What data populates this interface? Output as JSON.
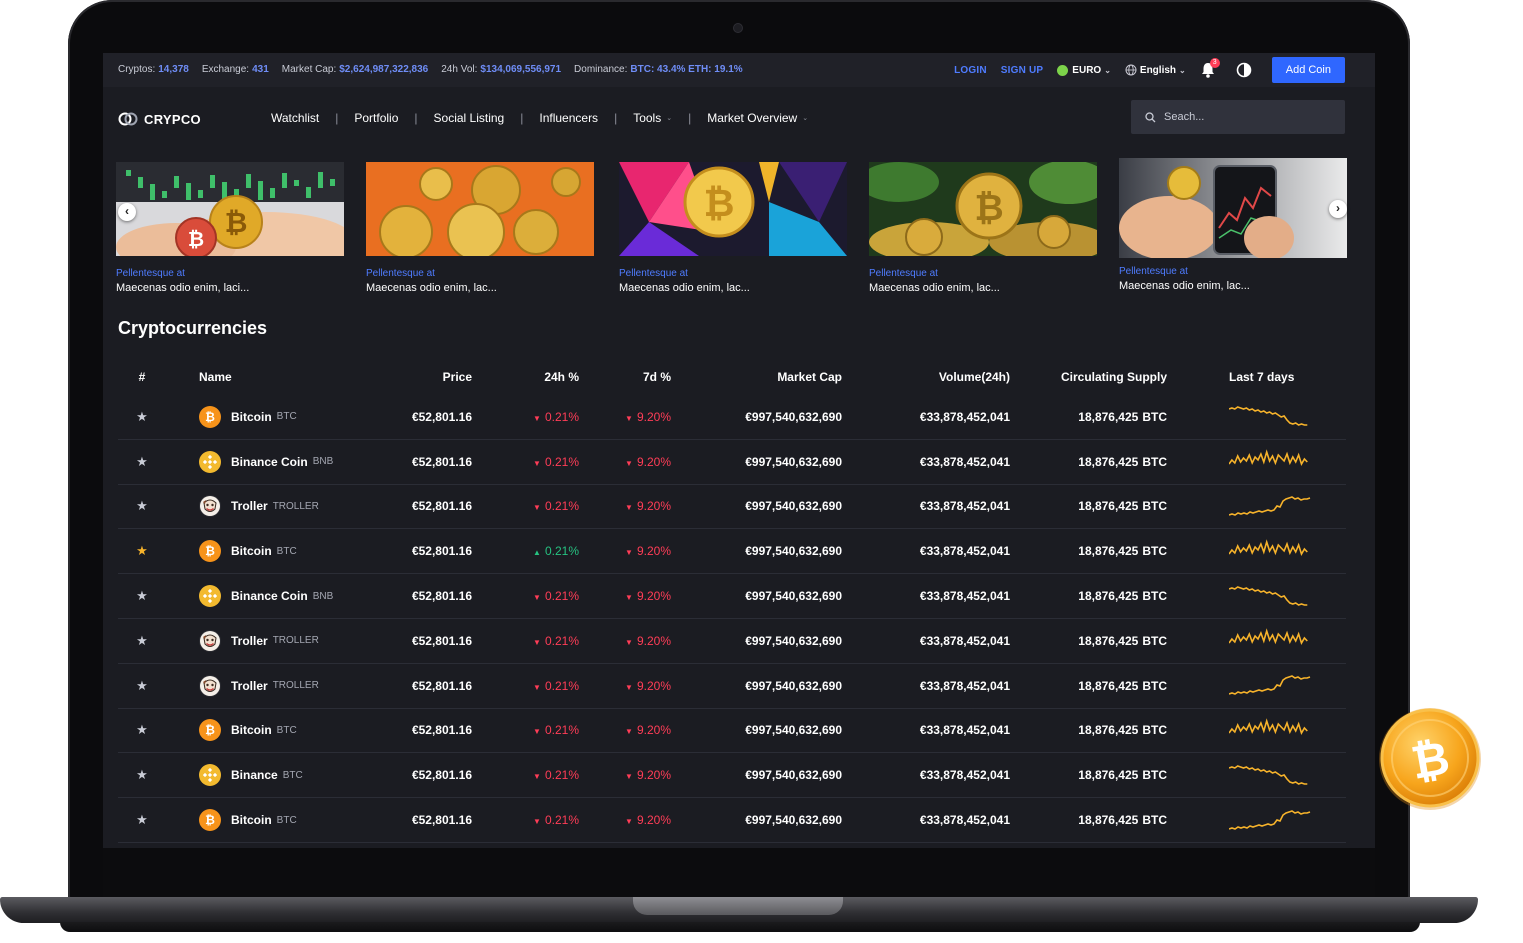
{
  "stats": [
    {
      "label": "Cryptos:",
      "value": "14,378"
    },
    {
      "label": "Exchange:",
      "value": "431"
    },
    {
      "label": "Market Cap:",
      "value": "$2,624,987,322,836"
    },
    {
      "label": "24h Vol:",
      "value": "$134,069,556,971"
    },
    {
      "label": "Dominance:",
      "value": "BTC: 43.4% ETH: 19.1%"
    }
  ],
  "topbar": {
    "login": "LOGIN",
    "signup": "SIGN UP",
    "currency": "EURO",
    "language": "English",
    "notifications": "3",
    "add_coin": "Add Coin"
  },
  "brand": "CRYPCO",
  "nav": [
    {
      "label": "Watchlist",
      "dropdown": false
    },
    {
      "label": "Portfolio",
      "dropdown": false
    },
    {
      "label": "Social Listing",
      "dropdown": false
    },
    {
      "label": "Influencers",
      "dropdown": false
    },
    {
      "label": "Tools",
      "dropdown": true
    },
    {
      "label": "Market Overview",
      "dropdown": true
    }
  ],
  "search": {
    "placeholder": "Seach..."
  },
  "news": [
    {
      "tag": "Pellentesque at",
      "title": "Maecenas odio enim, laci..."
    },
    {
      "tag": "Pellentesque at",
      "title": "Maecenas odio enim, lac..."
    },
    {
      "tag": "Pellentesque at",
      "title": "Maecenas odio enim, lac..."
    },
    {
      "tag": "Pellentesque at",
      "title": "Maecenas odio enim, lac..."
    },
    {
      "tag": "Pellentesque at",
      "title": "Maecenas odio enim, lac..."
    }
  ],
  "section_title": "Cryptocurrencies",
  "table": {
    "headers": {
      "rank": "#",
      "name": "Name",
      "price": "Price",
      "change_24h": "24h %",
      "change_7d": "7d %",
      "market_cap": "Market Cap",
      "volume": "Volume(24h)",
      "supply": "Circulating Supply",
      "chart": "Last 7 days"
    },
    "rows": [
      {
        "fav": false,
        "coin": "btc",
        "name": "Bitcoin",
        "symbol": "BTC",
        "price": "€52,801.16",
        "c24": "0.21%",
        "c24_dir": "down",
        "c7": "9.20%",
        "c7_dir": "down",
        "mcap": "€997,540,632,690",
        "vol": "€33,878,452,041",
        "supply": "18,876,425",
        "supply_sym": "BTC",
        "spark": "decline"
      },
      {
        "fav": false,
        "coin": "bnb",
        "name": "Binance Coin",
        "symbol": "BNB",
        "price": "€52,801.16",
        "c24": "0.21%",
        "c24_dir": "down",
        "c7": "9.20%",
        "c7_dir": "down",
        "mcap": "€997,540,632,690",
        "vol": "€33,878,452,041",
        "supply": "18,876,425",
        "supply_sym": "BTC",
        "spark": "noisy"
      },
      {
        "fav": false,
        "coin": "troller",
        "name": "Troller",
        "symbol": "TROLLER",
        "price": "€52,801.16",
        "c24": "0.21%",
        "c24_dir": "down",
        "c7": "9.20%",
        "c7_dir": "down",
        "mcap": "€997,540,632,690",
        "vol": "€33,878,452,041",
        "supply": "18,876,425",
        "supply_sym": "BTC",
        "spark": "rise"
      },
      {
        "fav": true,
        "coin": "btc",
        "name": "Bitcoin",
        "symbol": "BTC",
        "price": "€52,801.16",
        "c24": "0.21%",
        "c24_dir": "up",
        "c7": "9.20%",
        "c7_dir": "down",
        "mcap": "€997,540,632,690",
        "vol": "€33,878,452,041",
        "supply": "18,876,425",
        "supply_sym": "BTC",
        "spark": "noisy"
      },
      {
        "fav": false,
        "coin": "bnb",
        "name": "Binance Coin",
        "symbol": "BNB",
        "price": "€52,801.16",
        "c24": "0.21%",
        "c24_dir": "down",
        "c7": "9.20%",
        "c7_dir": "down",
        "mcap": "€997,540,632,690",
        "vol": "€33,878,452,041",
        "supply": "18,876,425",
        "supply_sym": "BTC",
        "spark": "decline"
      },
      {
        "fav": false,
        "coin": "troller",
        "name": "Troller",
        "symbol": "TROLLER",
        "price": "€52,801.16",
        "c24": "0.21%",
        "c24_dir": "down",
        "c7": "9.20%",
        "c7_dir": "down",
        "mcap": "€997,540,632,690",
        "vol": "€33,878,452,041",
        "supply": "18,876,425",
        "supply_sym": "BTC",
        "spark": "noisy"
      },
      {
        "fav": false,
        "coin": "troller",
        "name": "Troller",
        "symbol": "TROLLER",
        "price": "€52,801.16",
        "c24": "0.21%",
        "c24_dir": "down",
        "c7": "9.20%",
        "c7_dir": "down",
        "mcap": "€997,540,632,690",
        "vol": "€33,878,452,041",
        "supply": "18,876,425",
        "supply_sym": "BTC",
        "spark": "rise"
      },
      {
        "fav": false,
        "coin": "btc",
        "name": "Bitcoin",
        "symbol": "BTC",
        "price": "€52,801.16",
        "c24": "0.21%",
        "c24_dir": "down",
        "c7": "9.20%",
        "c7_dir": "down",
        "mcap": "€997,540,632,690",
        "vol": "€33,878,452,041",
        "supply": "18,876,425",
        "supply_sym": "BTC",
        "spark": "noisy"
      },
      {
        "fav": false,
        "coin": "bnb",
        "name": "Binance",
        "symbol": "BTC",
        "price": "€52,801.16",
        "c24": "0.21%",
        "c24_dir": "down",
        "c7": "9.20%",
        "c7_dir": "down",
        "mcap": "€997,540,632,690",
        "vol": "€33,878,452,041",
        "supply": "18,876,425",
        "supply_sym": "BTC",
        "spark": "decline"
      },
      {
        "fav": false,
        "coin": "btc",
        "name": "Bitcoin",
        "symbol": "BTC",
        "price": "€52,801.16",
        "c24": "0.21%",
        "c24_dir": "down",
        "c7": "9.20%",
        "c7_dir": "down",
        "mcap": "€997,540,632,690",
        "vol": "€33,878,452,041",
        "supply": "18,876,425",
        "supply_sym": "BTC",
        "spark": "rise"
      }
    ]
  },
  "colors": {
    "accent": "#2f67ff",
    "link": "#4f7cff",
    "negative": "#ff3d57",
    "positive": "#26c281",
    "bitcoin": "#f7931a",
    "binance": "#f3ba2f",
    "sparkline": "#f7b32b",
    "background": "#1b1c22"
  }
}
